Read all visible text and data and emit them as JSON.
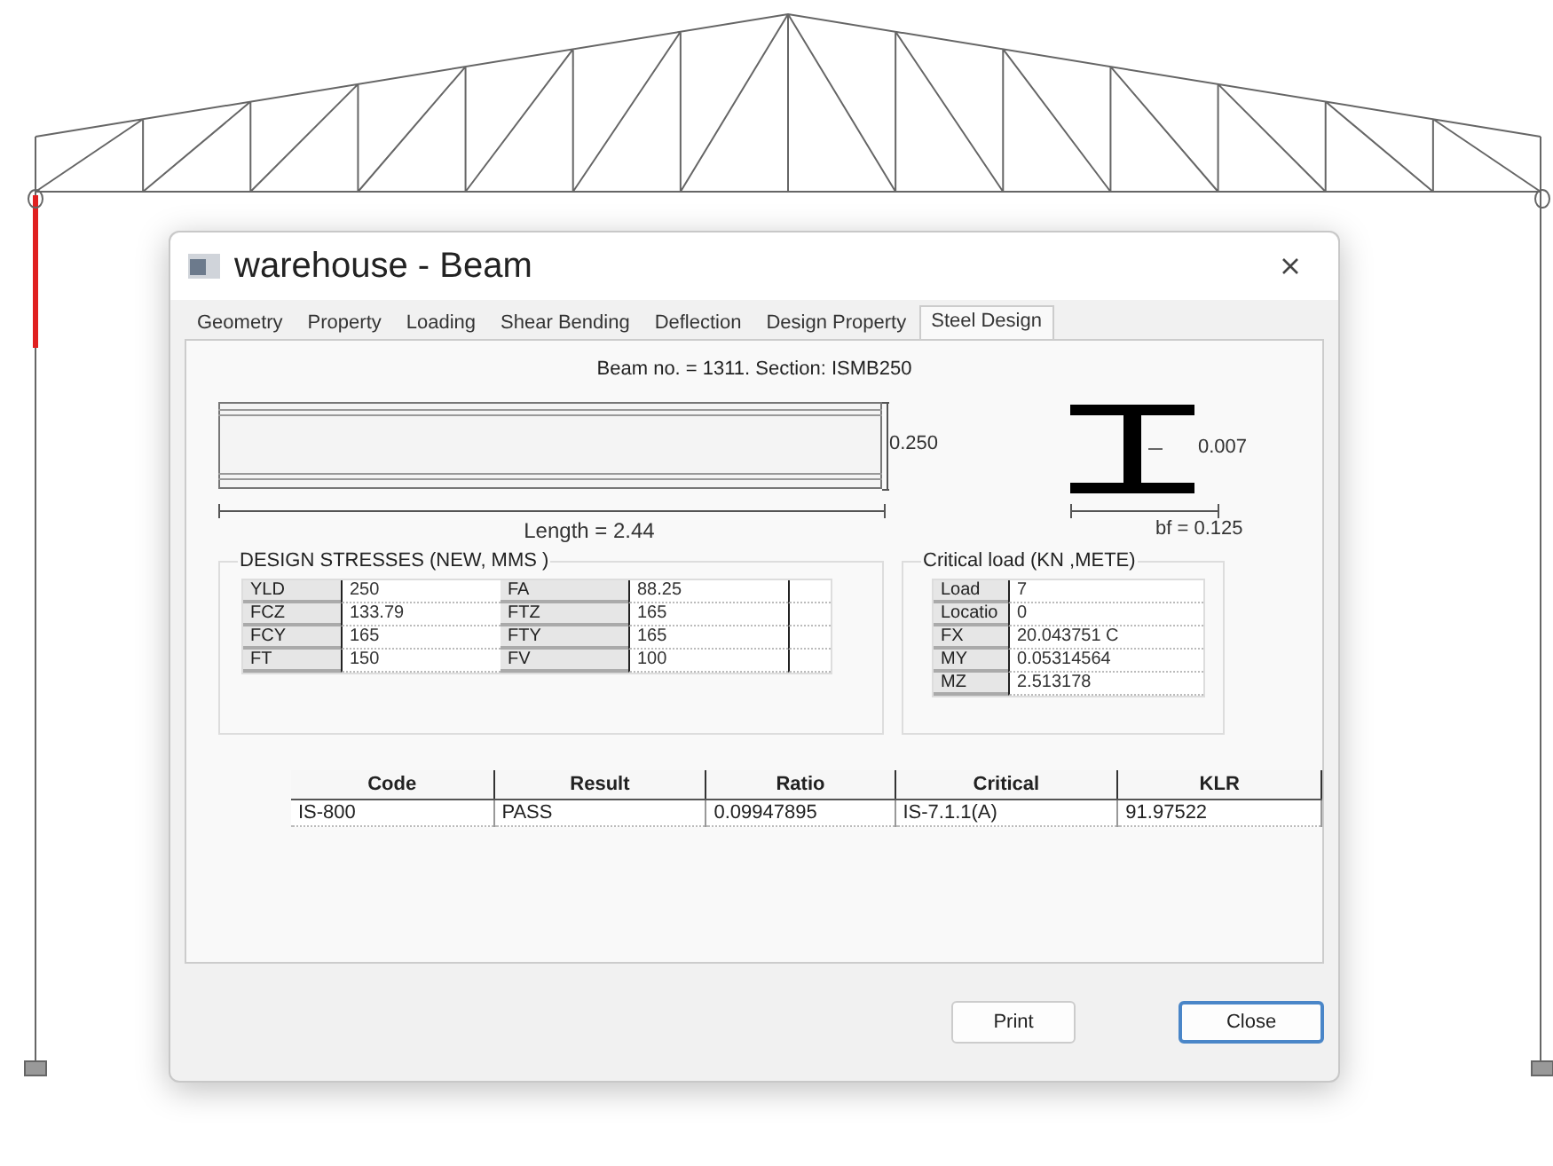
{
  "window": {
    "title": "warehouse - Beam"
  },
  "tabs": [
    {
      "label": "Geometry",
      "selected": false
    },
    {
      "label": "Property",
      "selected": false
    },
    {
      "label": "Loading",
      "selected": false
    },
    {
      "label": "Shear Bending",
      "selected": false
    },
    {
      "label": "Deflection",
      "selected": false
    },
    {
      "label": "Design Property",
      "selected": false
    },
    {
      "label": "Steel Design",
      "selected": true
    }
  ],
  "beam_info": "Beam no. = 1311. Section: ISMB250",
  "dimensions": {
    "depth": "0.250",
    "thickness": "0.007",
    "length": "Length = 2.44",
    "flange_width": "bf = 0.125"
  },
  "design_stresses": {
    "title": "DESIGN STRESSES (NEW, MMS )",
    "rows": [
      {
        "label_1": "YLD",
        "value_1": "250",
        "label_2": "FA",
        "value_2": "88.25"
      },
      {
        "label_1": "FCZ",
        "value_1": "133.79",
        "label_2": "FTZ",
        "value_2": "165"
      },
      {
        "label_1": "FCY",
        "value_1": "165",
        "label_2": "FTY",
        "value_2": "165"
      },
      {
        "label_1": "FT",
        "value_1": "150",
        "label_2": "FV",
        "value_2": "100"
      }
    ]
  },
  "critical_load": {
    "title": "Critical load (KN ,METE)",
    "rows": [
      {
        "label": "Load",
        "value": "7"
      },
      {
        "label": "Locatio",
        "value": "0"
      },
      {
        "label": "FX",
        "value": "20.043751 C"
      },
      {
        "label": "MY",
        "value": "0.05314564"
      },
      {
        "label": "MZ",
        "value": "2.513178"
      }
    ]
  },
  "results": {
    "columns": [
      "Code",
      "Result",
      "Ratio",
      "Critical",
      "KLR"
    ],
    "rows": [
      [
        "IS-800",
        "PASS",
        "0.09947895",
        "IS-7.1.1(A)",
        "91.97522"
      ]
    ]
  },
  "buttons": [
    {
      "label": "Print",
      "default": false
    },
    {
      "label": "Close",
      "default": true
    }
  ]
}
